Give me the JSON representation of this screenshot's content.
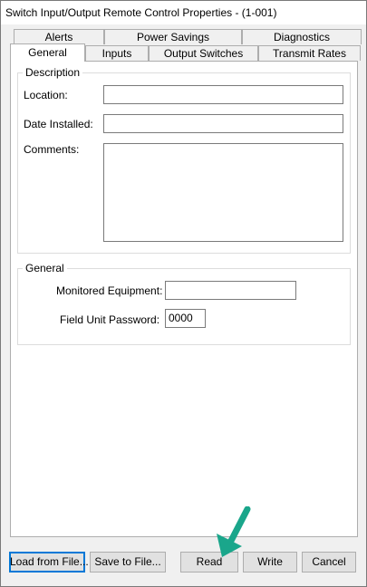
{
  "window": {
    "title": "Switch Input/Output Remote Control Properties -  (1-001)"
  },
  "tabs_back": [
    "Alerts",
    "Power Savings",
    "Diagnostics"
  ],
  "tabs_front": [
    "General",
    "Inputs",
    "Output Switches",
    "Transmit Rates"
  ],
  "active_tab": "General",
  "description_group": {
    "label": "Description",
    "location_label": "Location:",
    "location_value": "",
    "date_installed_label": "Date Installed:",
    "date_installed_value": "",
    "comments_label": "Comments:",
    "comments_value": ""
  },
  "general_group": {
    "label": "General",
    "monitored_equipment_label": "Monitored Equipment:",
    "monitored_equipment_value": "",
    "field_unit_password_label": "Field Unit Password:",
    "field_unit_password_value": "0000"
  },
  "buttons": {
    "load_from_file": "Load from File...",
    "save_to_file": "Save to File...",
    "read": "Read",
    "write": "Write",
    "cancel": "Cancel"
  },
  "colors": {
    "annotation_arrow": "#1aa68b",
    "focus_border": "#0078d7"
  },
  "annotation": {
    "icon": "arrow-pointing-to-read-button"
  }
}
